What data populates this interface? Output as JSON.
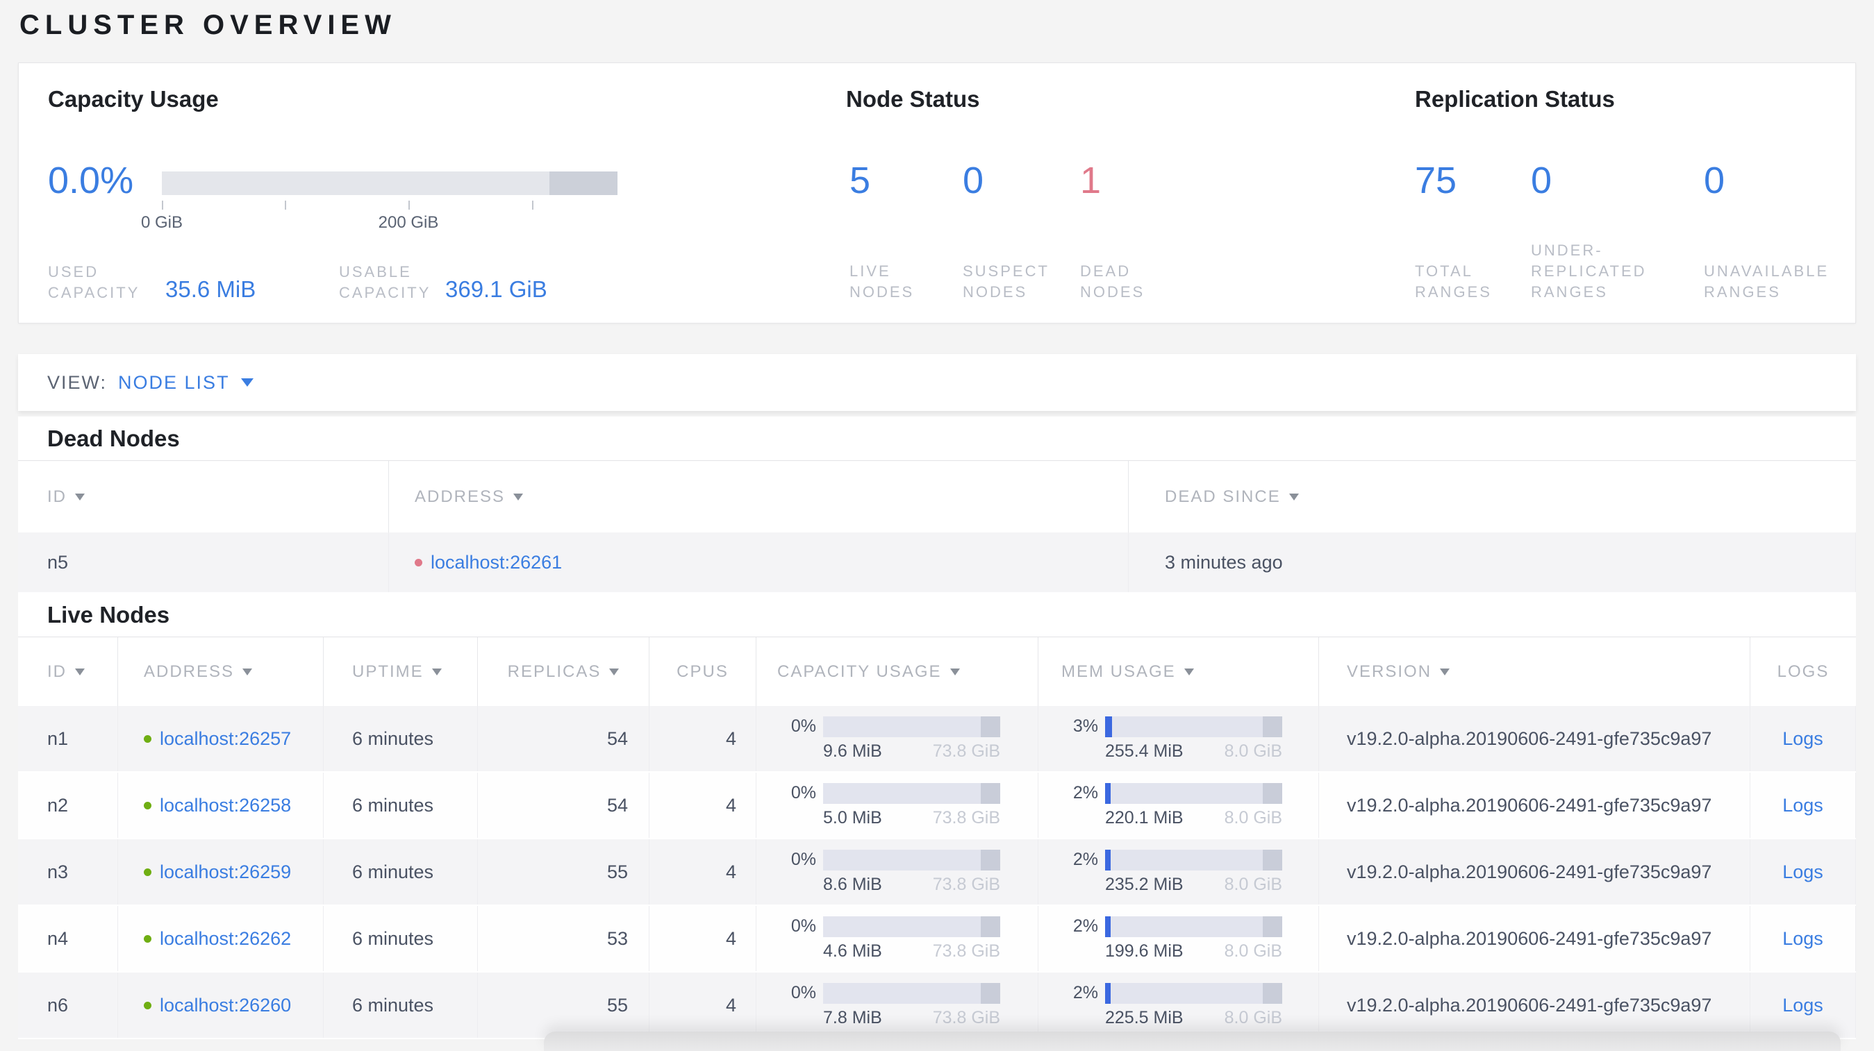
{
  "page": {
    "title": "CLUSTER OVERVIEW"
  },
  "summary": {
    "capacity_usage": {
      "heading": "Capacity Usage",
      "percent": "0.0%",
      "axis_ticks": [
        "0 GiB",
        "200 GiB"
      ],
      "used": {
        "label_lines": [
          "USED",
          "CAPACITY"
        ],
        "value": "35.6 MiB"
      },
      "usable": {
        "label_lines": [
          "USABLE",
          "CAPACITY"
        ],
        "value": "369.1 GiB"
      }
    },
    "node_status": {
      "heading": "Node Status",
      "live": {
        "value": "5",
        "label_lines": [
          "LIVE",
          "NODES"
        ]
      },
      "suspect": {
        "value": "0",
        "label_lines": [
          "SUSPECT",
          "NODES"
        ]
      },
      "dead": {
        "value": "1",
        "label_lines": [
          "DEAD",
          "NODES"
        ]
      }
    },
    "replication_status": {
      "heading": "Replication Status",
      "total": {
        "value": "75",
        "label_lines": [
          "TOTAL",
          "RANGES"
        ]
      },
      "under_replicated": {
        "value": "0",
        "label_lines": [
          "UNDER-",
          "REPLICATED",
          "RANGES"
        ]
      },
      "unavailable": {
        "value": "0",
        "label_lines": [
          "UNAVAILABLE",
          "RANGES"
        ]
      }
    }
  },
  "view_bar": {
    "label": "VIEW:",
    "selected": "NODE LIST"
  },
  "dead_nodes": {
    "heading": "Dead Nodes",
    "columns": [
      "ID",
      "ADDRESS",
      "DEAD SINCE"
    ],
    "rows": [
      {
        "id": "n5",
        "address": "localhost:26261",
        "dead_since": "3 minutes ago"
      }
    ]
  },
  "live_nodes": {
    "heading": "Live Nodes",
    "columns": [
      "ID",
      "ADDRESS",
      "UPTIME",
      "REPLICAS",
      "CPUS",
      "CAPACITY USAGE",
      "MEM USAGE",
      "VERSION",
      "LOGS"
    ],
    "rows": [
      {
        "id": "n1",
        "address": "localhost:26257",
        "uptime": "6 minutes",
        "replicas": "54",
        "cpus": "4",
        "capacity": {
          "percent": "0%",
          "used": "9.6 MiB",
          "total": "73.8 GiB"
        },
        "memory": {
          "percent": "3%",
          "used": "255.4 MiB",
          "total": "8.0 GiB"
        },
        "version": "v19.2.0-alpha.20190606-2491-gfe735c9a97",
        "logs_label": "Logs"
      },
      {
        "id": "n2",
        "address": "localhost:26258",
        "uptime": "6 minutes",
        "replicas": "54",
        "cpus": "4",
        "capacity": {
          "percent": "0%",
          "used": "5.0 MiB",
          "total": "73.8 GiB"
        },
        "memory": {
          "percent": "2%",
          "used": "220.1 MiB",
          "total": "8.0 GiB"
        },
        "version": "v19.2.0-alpha.20190606-2491-gfe735c9a97",
        "logs_label": "Logs"
      },
      {
        "id": "n3",
        "address": "localhost:26259",
        "uptime": "6 minutes",
        "replicas": "55",
        "cpus": "4",
        "capacity": {
          "percent": "0%",
          "used": "8.6 MiB",
          "total": "73.8 GiB"
        },
        "memory": {
          "percent": "2%",
          "used": "235.2 MiB",
          "total": "8.0 GiB"
        },
        "version": "v19.2.0-alpha.20190606-2491-gfe735c9a97",
        "logs_label": "Logs"
      },
      {
        "id": "n4",
        "address": "localhost:26262",
        "uptime": "6 minutes",
        "replicas": "53",
        "cpus": "4",
        "capacity": {
          "percent": "0%",
          "used": "4.6 MiB",
          "total": "73.8 GiB"
        },
        "memory": {
          "percent": "2%",
          "used": "199.6 MiB",
          "total": "8.0 GiB"
        },
        "version": "v19.2.0-alpha.20190606-2491-gfe735c9a97",
        "logs_label": "Logs"
      },
      {
        "id": "n6",
        "address": "localhost:26260",
        "uptime": "6 minutes",
        "replicas": "55",
        "cpus": "4",
        "capacity": {
          "percent": "0%",
          "used": "7.8 MiB",
          "total": "73.8 GiB"
        },
        "memory": {
          "percent": "2%",
          "used": "225.5 MiB",
          "total": "8.0 GiB"
        },
        "version": "v19.2.0-alpha.20190606-2491-gfe735c9a97",
        "logs_label": "Logs"
      }
    ]
  },
  "colors": {
    "accent_blue": "#3a7de1",
    "alert_red": "#e0798a",
    "healthy_green": "#6fae13"
  }
}
